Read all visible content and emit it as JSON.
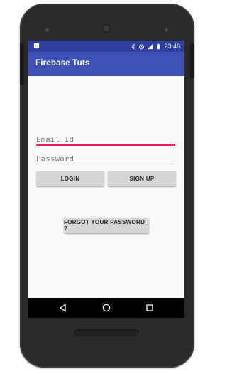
{
  "status_bar": {
    "time": "23:48",
    "icons": [
      "android-icon",
      "bluetooth-icon",
      "alarm-icon",
      "wifi-icon",
      "signal-icon",
      "battery-icon"
    ]
  },
  "toolbar": {
    "title": "Firebase Tuts"
  },
  "form": {
    "email_placeholder": "Email Id",
    "password_placeholder": "Password",
    "login_label": "LOGIN",
    "signup_label": "SIGN UP",
    "forgot_label": "FORGOT YOUR PASSWORD ?"
  },
  "nav_bar": {
    "icons": [
      "back-icon",
      "home-icon",
      "recents-icon"
    ]
  },
  "colors": {
    "status_bar": "#303f9f",
    "toolbar": "#3f51b5",
    "accent": "#e91e63",
    "button": "#d6d6d6"
  }
}
